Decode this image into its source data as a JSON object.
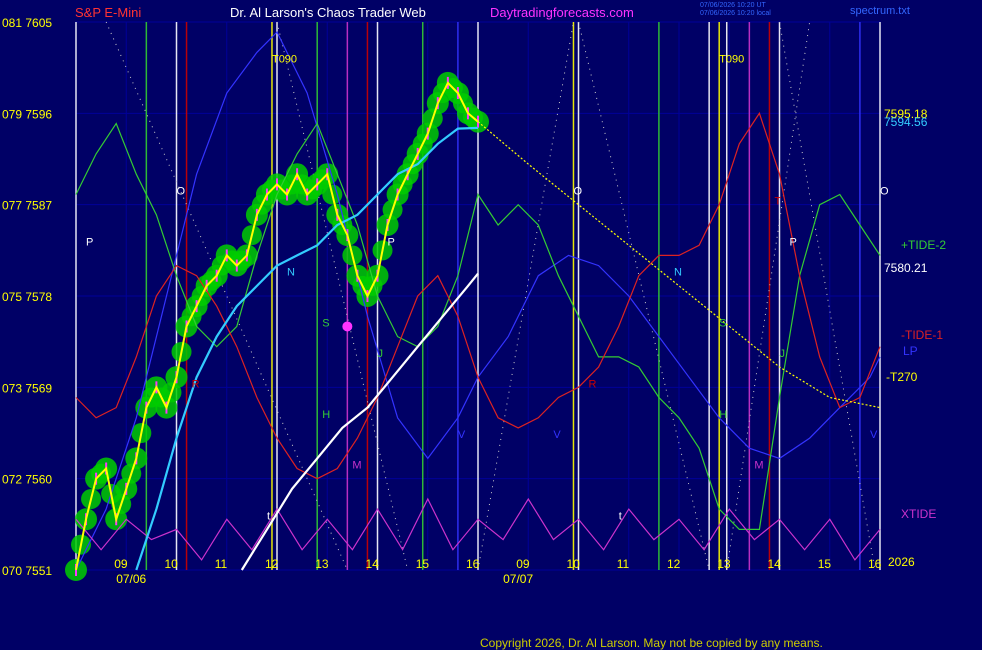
{
  "header": {
    "symbol": "S&P E-Mini",
    "title": "Dr. Al Larson's Chaos Trader Web",
    "site": "Daytradingforecasts.com",
    "stamp1": "07/06/2026 10:20 UT",
    "stamp2": "07/06/2026 10:20 local",
    "file": "spectrum.txt"
  },
  "footer": {
    "copyright": "Copyright 2026, Dr. Al Larson. May not be copied by any means."
  },
  "colors": {
    "background": "#000066",
    "grid": "#000099",
    "price": "#ffff00",
    "price_glow": "#00cc00",
    "bars": "#ff33ff",
    "ma_fast": "#33ccff",
    "ma_slow": "#ffffff",
    "tide2": "#33cc33",
    "tide1": "#dd2222",
    "lp": "#3333ff",
    "xtide": "#cc33cc",
    "forecast": "#ffff00"
  },
  "chart_data": {
    "type": "line",
    "title": "S&P E-Mini",
    "ylim": [
      7551,
      7605
    ],
    "y_ticks": [
      {
        "value": 7605,
        "label": "081  7605"
      },
      {
        "value": 7596,
        "label": "079  7596"
      },
      {
        "value": 7587,
        "label": "077  7587"
      },
      {
        "value": 7578,
        "label": "075  7578"
      },
      {
        "value": 7569,
        "label": "073  7569"
      },
      {
        "value": 7560,
        "label": "072  7560"
      },
      {
        "value": 7551,
        "label": "070  7551"
      }
    ],
    "xlim": [
      8.0,
      24.0
    ],
    "x_ticks": [
      {
        "x": 9,
        "label": "09"
      },
      {
        "x": 10,
        "label": "10"
      },
      {
        "x": 11,
        "label": "11"
      },
      {
        "x": 12,
        "label": "12"
      },
      {
        "x": 13,
        "label": "13"
      },
      {
        "x": 14,
        "label": "14"
      },
      {
        "x": 15,
        "label": "15"
      },
      {
        "x": 16,
        "label": "16"
      },
      {
        "x": 17,
        "label": "09"
      },
      {
        "x": 18,
        "label": "10"
      },
      {
        "x": 19,
        "label": "11"
      },
      {
        "x": 20,
        "label": "12"
      },
      {
        "x": 21,
        "label": "13"
      },
      {
        "x": 22,
        "label": "14"
      },
      {
        "x": 23,
        "label": "15"
      },
      {
        "x": 24,
        "label": "16"
      }
    ],
    "dates": [
      {
        "x": 8.8,
        "label": "07/06"
      },
      {
        "x": 16.5,
        "label": "07/07"
      }
    ],
    "year_label": "2026",
    "price_labels": [
      {
        "text": "7595.18",
        "value": 7594.6,
        "color": "#ffff00"
      },
      {
        "text": "7594.56",
        "value": 7593.8,
        "color": "#33ccff"
      },
      {
        "text": "7580.21",
        "value": 7579.8,
        "color": "#ffffff"
      }
    ],
    "series": [
      {
        "name": "Price",
        "color": "#ffff00",
        "x": [
          8.0,
          8.2,
          8.4,
          8.6,
          8.8,
          9.0,
          9.2,
          9.4,
          9.6,
          9.8,
          10.0,
          10.2,
          10.4,
          10.6,
          10.8,
          11.0,
          11.2,
          11.4,
          11.6,
          11.8,
          12.0,
          12.2,
          12.4,
          12.6,
          12.8,
          13.0,
          13.2,
          13.4,
          13.6,
          13.8,
          14.0,
          14.2,
          14.4,
          14.6,
          14.8,
          15.0,
          15.2,
          15.4,
          15.6,
          15.8,
          16.0
        ],
        "y": [
          7551,
          7556,
          7560,
          7561,
          7556,
          7559,
          7562,
          7567,
          7569,
          7567,
          7570,
          7575,
          7577,
          7579,
          7580,
          7582,
          7581,
          7582,
          7586,
          7588,
          7589,
          7588,
          7590,
          7588,
          7589,
          7590,
          7586,
          7584,
          7580,
          7578,
          7580,
          7585,
          7588,
          7590,
          7592,
          7594,
          7597,
          7599,
          7598,
          7596,
          7595.18
        ]
      },
      {
        "name": "",
        "color": "#33ccff",
        "x": [
          9.2,
          9.6,
          10.0,
          10.4,
          10.8,
          11.2,
          11.6,
          12.0,
          12.4,
          12.8,
          13.2,
          13.6,
          14.0,
          14.4,
          14.8,
          15.2,
          15.6,
          16.0
        ],
        "y": [
          7551,
          7557,
          7564,
          7570,
          7574,
          7577,
          7579,
          7581,
          7582,
          7583,
          7585,
          7586,
          7588,
          7590,
          7591,
          7593,
          7594.5,
          7594.56
        ]
      },
      {
        "name": "",
        "color": "#ffffff",
        "x": [
          11.3,
          11.8,
          12.3,
          12.8,
          13.3,
          13.8,
          14.3,
          14.8,
          15.3,
          15.8,
          16.0
        ],
        "y": [
          7551,
          7555,
          7559,
          7562,
          7565,
          7567,
          7570,
          7573,
          7576,
          7579,
          7580.21
        ]
      },
      {
        "name": "+TIDE-2",
        "color": "#33cc33",
        "x": [
          8.0,
          8.4,
          8.8,
          9.2,
          9.6,
          10.0,
          10.4,
          10.8,
          11.2,
          11.6,
          12.0,
          12.4,
          12.8,
          13.2,
          13.6,
          14.0,
          14.4,
          14.8,
          15.2,
          15.6,
          16.0,
          16.4,
          16.8,
          17.2,
          17.6,
          18.0,
          18.4,
          18.8,
          19.2,
          19.6,
          20.0,
          20.4,
          20.8,
          21.2,
          21.6,
          22.0,
          22.4,
          22.8,
          23.2,
          23.6,
          24.0
        ],
        "y": [
          7588,
          7592,
          7595,
          7590,
          7586,
          7580,
          7575,
          7573,
          7575,
          7582,
          7588,
          7592,
          7595,
          7590,
          7585,
          7578,
          7574,
          7573,
          7575,
          7580,
          7588,
          7585,
          7587,
          7585,
          7580,
          7576,
          7572,
          7572,
          7571,
          7568,
          7566,
          7563,
          7557,
          7555,
          7555,
          7568,
          7580,
          7587,
          7588,
          7585,
          7582
        ]
      },
      {
        "name": "-TIDE-1",
        "color": "#dd2222",
        "x": [
          8.0,
          8.4,
          8.8,
          9.2,
          9.6,
          10.0,
          10.4,
          10.8,
          11.2,
          11.6,
          12.0,
          12.4,
          12.8,
          13.2,
          13.6,
          14.0,
          14.4,
          14.8,
          15.2,
          15.6,
          16.0,
          16.4,
          16.8,
          17.2,
          17.6,
          18.0,
          18.4,
          18.8,
          19.2,
          19.6,
          20.0,
          20.4,
          20.8,
          21.2,
          21.6,
          22.0,
          22.4,
          22.8,
          23.2,
          23.6,
          24.0
        ],
        "y": [
          7568,
          7566,
          7567,
          7572,
          7578,
          7581,
          7580,
          7577,
          7573,
          7568,
          7564,
          7561,
          7560,
          7561,
          7564,
          7568,
          7573,
          7578,
          7580,
          7576,
          7570,
          7566,
          7565,
          7566,
          7568,
          7569,
          7571,
          7575,
          7580,
          7582,
          7582,
          7583,
          7587,
          7593,
          7596,
          7590,
          7580,
          7572,
          7567,
          7568,
          7573
        ]
      },
      {
        "name": "LP",
        "color": "#3333ff",
        "x": [
          8.0,
          8.6,
          9.2,
          9.8,
          10.4,
          11.0,
          11.6,
          12.0,
          12.6,
          13.2,
          13.8,
          14.4,
          15.0,
          15.6,
          16.0,
          16.6,
          17.2,
          17.8,
          18.4,
          19.0,
          19.6,
          20.2,
          20.8,
          21.4,
          22.0,
          22.6,
          23.2,
          23.8,
          24.0
        ],
        "y": [
          7551,
          7557,
          7566,
          7578,
          7590,
          7598,
          7602,
          7604,
          7598,
          7588,
          7576,
          7566,
          7562,
          7566,
          7570,
          7574,
          7580,
          7582,
          7581,
          7578,
          7574,
          7570,
          7566,
          7563,
          7562,
          7564,
          7567,
          7570,
          7572
        ]
      },
      {
        "name": "XTIDE",
        "color": "#cc33cc",
        "x": [
          8.0,
          8.5,
          9.0,
          9.5,
          10.0,
          10.5,
          11.0,
          11.5,
          12.0,
          12.5,
          13.0,
          13.5,
          14.0,
          14.5,
          15.0,
          15.5,
          16.0,
          16.5,
          17.0,
          17.5,
          18.0,
          18.5,
          19.0,
          19.5,
          20.0,
          20.5,
          21.0,
          21.5,
          22.0,
          22.5,
          23.0,
          23.5,
          24.0
        ],
        "y": [
          7556,
          7553,
          7556,
          7554,
          7555,
          7552,
          7556,
          7553,
          7557,
          7553,
          7556,
          7553,
          7557,
          7553,
          7558,
          7553,
          7556,
          7554,
          7558,
          7554,
          7556,
          7553,
          7557,
          7554,
          7556,
          7553,
          7557,
          7554,
          7556,
          7553,
          7556,
          7552,
          7555
        ]
      },
      {
        "name": "T270",
        "color": "#ffff00",
        "x": [
          16.0,
          17.0,
          18.0,
          19.0,
          20.0,
          21.0,
          22.0,
          23.0,
          24.0
        ],
        "y": [
          7595.18,
          7591,
          7587,
          7583,
          7579,
          7575,
          7571,
          7568,
          7567
        ]
      }
    ],
    "legend": [
      {
        "text": "+TIDE-2",
        "color": "#33cc33"
      },
      {
        "text": "7580.21",
        "color": "#ffffff"
      },
      {
        "text": "-TIDE-1",
        "color": "#dd2222"
      },
      {
        "text": "LP",
        "color": "#3333ff"
      },
      {
        "text": "T270",
        "color": "#ffff00"
      },
      {
        "text": "XTIDE",
        "color": "#cc33cc"
      }
    ],
    "vlines": [
      {
        "x": 8.0,
        "color": "#ffffff"
      },
      {
        "x": 9.4,
        "color": "#33cc33"
      },
      {
        "x": 10.0,
        "color": "#ffffff"
      },
      {
        "x": 10.2,
        "color": "#cc0000"
      },
      {
        "x": 11.9,
        "color": "#ffff00"
      },
      {
        "x": 12.0,
        "color": "#ffffff"
      },
      {
        "x": 12.8,
        "color": "#33cc33"
      },
      {
        "x": 13.4,
        "color": "#cc33cc"
      },
      {
        "x": 13.8,
        "color": "#cc0000"
      },
      {
        "x": 14.0,
        "color": "#ffffff"
      },
      {
        "x": 14.9,
        "color": "#33cc33"
      },
      {
        "x": 15.6,
        "color": "#3333ff"
      },
      {
        "x": 16.0,
        "color": "#ffffff"
      },
      {
        "x": 17.9,
        "color": "#ffff00"
      },
      {
        "x": 18.0,
        "color": "#ffffff"
      },
      {
        "x": 19.6,
        "color": "#33cc33"
      },
      {
        "x": 20.6,
        "color": "#ffffff"
      },
      {
        "x": 20.8,
        "color": "#ffff00"
      },
      {
        "x": 20.95,
        "color": "#ffffff"
      },
      {
        "x": 21.4,
        "color": "#cc33cc"
      },
      {
        "x": 21.8,
        "color": "#cc0000"
      },
      {
        "x": 22.0,
        "color": "#ffffff"
      },
      {
        "x": 23.6,
        "color": "#3333ff"
      },
      {
        "x": 24.0,
        "color": "#ffffff"
      }
    ],
    "annotations": [
      {
        "text": "T090",
        "x": 11.9,
        "y": 7601,
        "color": "#ffff00"
      },
      {
        "text": "T090",
        "x": 20.8,
        "y": 7601,
        "color": "#ffff00"
      },
      {
        "text": "O",
        "x": 10.0,
        "y": 7588,
        "color": "#ffffff"
      },
      {
        "text": "O",
        "x": 17.9,
        "y": 7588,
        "color": "#ffffff"
      },
      {
        "text": "O",
        "x": 24.0,
        "y": 7588,
        "color": "#ffffff"
      },
      {
        "text": "P",
        "x": 8.2,
        "y": 7583,
        "color": "#ffffff"
      },
      {
        "text": "P",
        "x": 14.2,
        "y": 7583,
        "color": "#ffffff"
      },
      {
        "text": "P",
        "x": 22.2,
        "y": 7583,
        "color": "#ffffff"
      },
      {
        "text": "N",
        "x": 12.2,
        "y": 7580,
        "color": "#33ccff"
      },
      {
        "text": "N",
        "x": 19.9,
        "y": 7580,
        "color": "#33ccff"
      },
      {
        "text": "S",
        "x": 12.9,
        "y": 7575,
        "color": "#33cc33"
      },
      {
        "text": "S",
        "x": 20.8,
        "y": 7575,
        "color": "#33cc33"
      },
      {
        "text": "J",
        "x": 14.0,
        "y": 7572,
        "color": "#33cc33"
      },
      {
        "text": "J",
        "x": 22.0,
        "y": 7572,
        "color": "#33cc33"
      },
      {
        "text": "H",
        "x": 12.9,
        "y": 7566,
        "color": "#33cc33"
      },
      {
        "text": "H",
        "x": 20.8,
        "y": 7566,
        "color": "#33cc33"
      },
      {
        "text": "M",
        "x": 13.5,
        "y": 7561,
        "color": "#cc33cc"
      },
      {
        "text": "M",
        "x": 21.5,
        "y": 7561,
        "color": "#cc33cc"
      },
      {
        "text": "R",
        "x": 10.3,
        "y": 7569,
        "color": "#cc0000"
      },
      {
        "text": "R",
        "x": 18.2,
        "y": 7569,
        "color": "#cc0000"
      },
      {
        "text": "V",
        "x": 15.6,
        "y": 7564,
        "color": "#3333ff"
      },
      {
        "text": "V",
        "x": 17.5,
        "y": 7564,
        "color": "#3333ff"
      },
      {
        "text": "V",
        "x": 23.8,
        "y": 7564,
        "color": "#3333ff"
      },
      {
        "text": "t",
        "x": 11.8,
        "y": 7556,
        "color": "#ffffff"
      },
      {
        "text": "t",
        "x": 18.8,
        "y": 7556,
        "color": "#ffffff"
      },
      {
        "text": "T",
        "x": 21.9,
        "y": 7587,
        "color": "#cc0000"
      }
    ]
  }
}
